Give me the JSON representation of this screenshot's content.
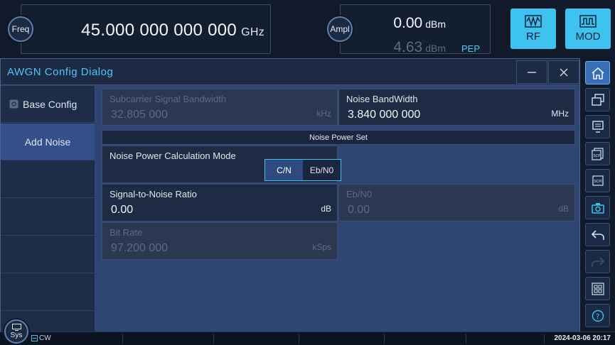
{
  "top": {
    "freq_button": "Freq",
    "freq_value": "45.000 000 000 000",
    "freq_unit": "GHz",
    "ampl_button": "Ampl",
    "ampl_value": "0.00",
    "ampl_unit": "dBm",
    "pep_value": "4.63",
    "pep_unit": "dBm",
    "pep_label": "PEP",
    "rf_label": "RF",
    "mod_label": "MOD"
  },
  "dialog": {
    "title": "AWGN Config Dialog",
    "nav": [
      {
        "label": "Base Config"
      },
      {
        "label": "Add Noise"
      }
    ],
    "subcarrier_bw": {
      "label": "Subcarrier Signal Bandwidth",
      "value": "32.805 000",
      "unit": "kHz"
    },
    "noise_bw": {
      "label": "Noise BandWidth",
      "value": "3.840 000 000",
      "unit": "MHz"
    },
    "section_title": "Noise Power Set",
    "calc_mode": {
      "label": "Noise Power Calculation Mode",
      "options": [
        "C/N",
        "Eb/N0"
      ],
      "selected": "C/N"
    },
    "snr": {
      "label": "Signal-to-Noise Ratio",
      "value": "0.00",
      "unit": "dB"
    },
    "ebn0": {
      "label": "Eb/N0",
      "value": "0.00",
      "unit": "dB"
    },
    "bit_rate": {
      "label": "Bit Rate",
      "value": "97.200 000",
      "unit": "kSps"
    }
  },
  "status": {
    "sys_label": "Sys",
    "cw_label": "CW",
    "datetime": "2024-03-06 20:17"
  },
  "colors": {
    "accent": "#3ec2f0",
    "title": "#4cc6f2",
    "dialog_bg": "#2f4672"
  }
}
